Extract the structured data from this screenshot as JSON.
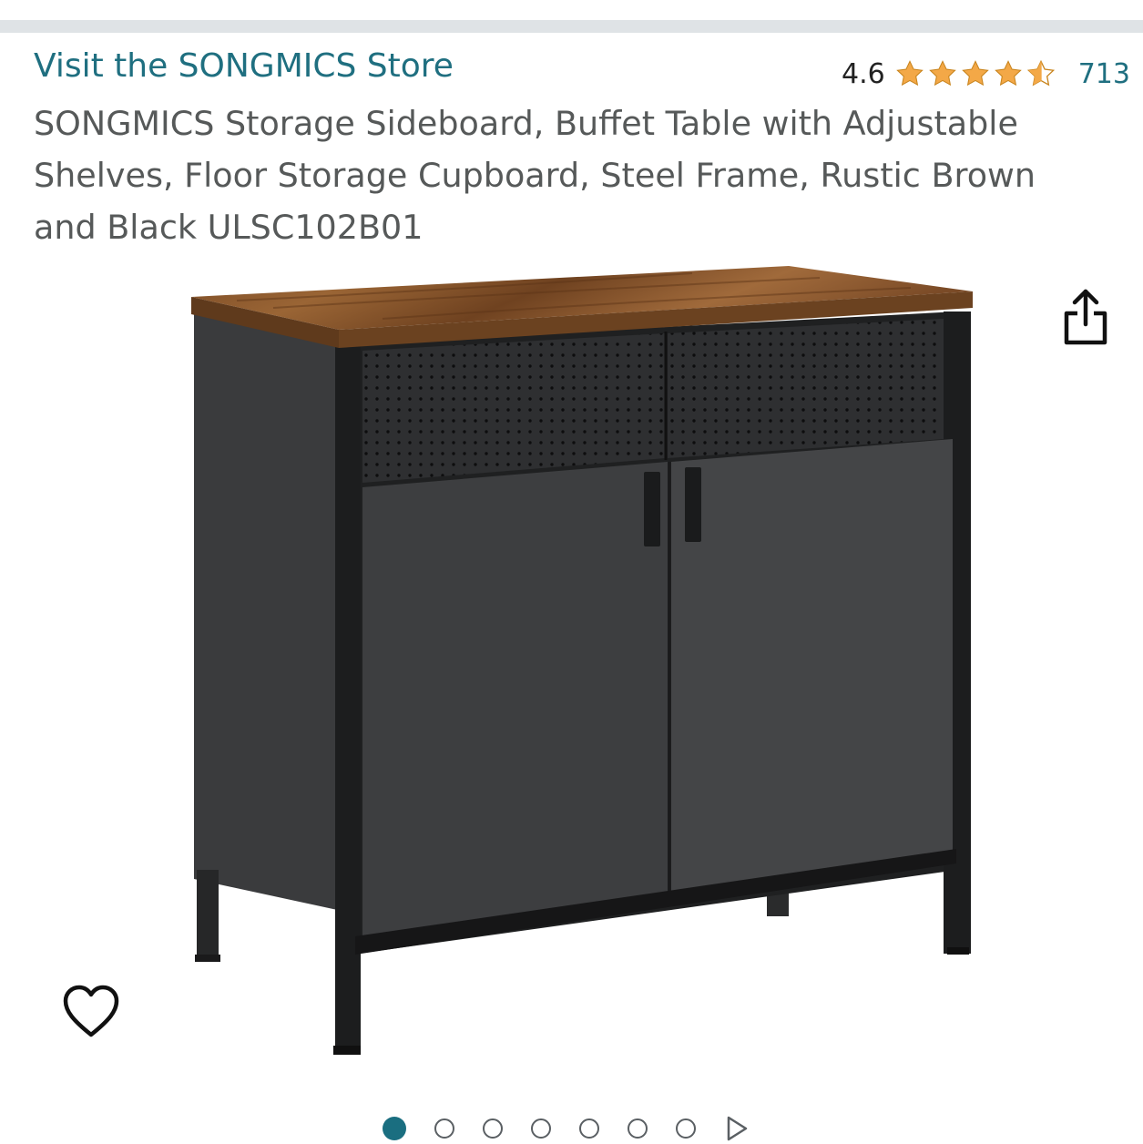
{
  "header": {
    "store_link": "Visit the SONGMICS Store",
    "rating_value": "4.6",
    "rating_stars": 4.6,
    "rating_count": "713",
    "star_color": "#f3a847"
  },
  "product": {
    "title": "SONGMICS Storage Sideboard, Buffet Table with Adjustable Shelves, Floor Storage Cupboard, Steel Frame, Rustic Brown and Black ULSC102B01"
  },
  "gallery": {
    "image_count": 7,
    "active_index": 0,
    "accent_color": "#1a6e80",
    "icons": [
      "share-icon",
      "heart-icon",
      "next-arrow-icon"
    ]
  }
}
